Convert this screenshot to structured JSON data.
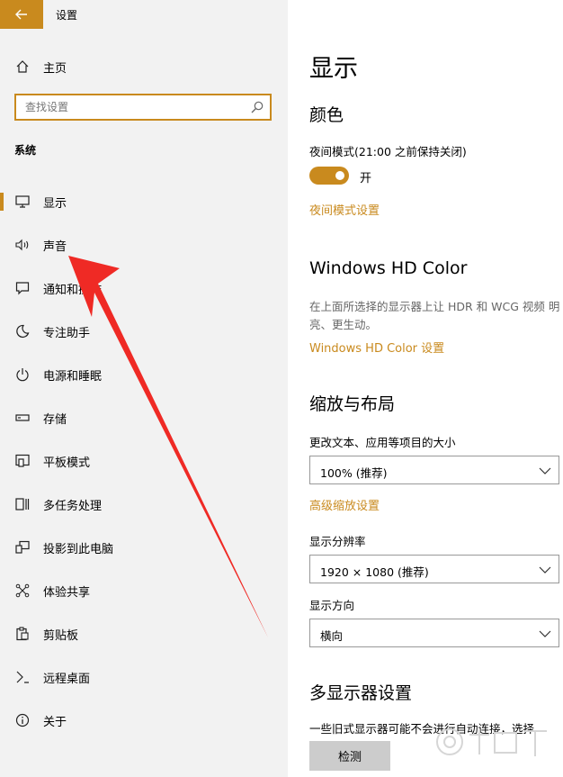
{
  "window": {
    "title": "设置"
  },
  "sidebar": {
    "home_label": "主页",
    "search_placeholder": "查找设置",
    "section_label": "系统",
    "items": [
      {
        "label": "显示",
        "icon": "monitor-icon",
        "selected": true
      },
      {
        "label": "声音",
        "icon": "speaker-icon"
      },
      {
        "label": "通知和操作",
        "icon": "notification-icon"
      },
      {
        "label": "专注助手",
        "icon": "moon-icon"
      },
      {
        "label": "电源和睡眠",
        "icon": "power-icon"
      },
      {
        "label": "存储",
        "icon": "storage-icon"
      },
      {
        "label": "平板模式",
        "icon": "tablet-mode-icon"
      },
      {
        "label": "多任务处理",
        "icon": "multitasking-icon"
      },
      {
        "label": "投影到此电脑",
        "icon": "projecting-icon"
      },
      {
        "label": "体验共享",
        "icon": "shared-experiences-icon"
      },
      {
        "label": "剪贴板",
        "icon": "clipboard-icon"
      },
      {
        "label": "远程桌面",
        "icon": "remote-desktop-icon"
      },
      {
        "label": "关于",
        "icon": "info-icon"
      }
    ]
  },
  "main": {
    "title": "显示",
    "color": {
      "heading": "颜色",
      "night_light_label": "夜间模式(21:00 之前保持关闭)",
      "toggle_state": "开",
      "night_light_link": "夜间模式设置"
    },
    "hdr": {
      "heading": "Windows HD Color",
      "description": "在上面所选择的显示器上让 HDR 和 WCG 视频 明亮、更生动。",
      "link": "Windows HD Color 设置"
    },
    "scale": {
      "heading": "缩放与布局",
      "size_label": "更改文本、应用等项目的大小",
      "size_value": "100% (推荐)",
      "advanced_link": "高级缩放设置",
      "resolution_label": "显示分辨率",
      "resolution_value": "1920 × 1080 (推荐)",
      "orientation_label": "显示方向",
      "orientation_value": "横向"
    },
    "multi": {
      "heading": "多显示器设置",
      "description": "一些旧式显示器可能不会进行自动连接，选择",
      "detect_button": "检测"
    }
  },
  "colors": {
    "accent": "#c98a1e",
    "arrow": "#ef2a25",
    "sidebar_bg": "#f2f2f2"
  }
}
